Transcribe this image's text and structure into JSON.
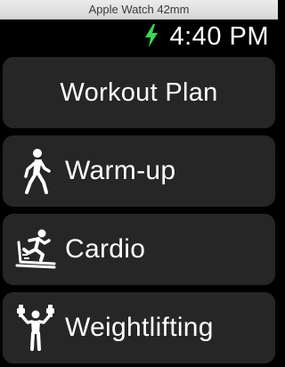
{
  "window": {
    "title": "Apple Watch 42mm"
  },
  "status": {
    "time": "4:40 PM",
    "charging_color": "#3cd651"
  },
  "workout": {
    "title": "Workout Plan",
    "items": [
      {
        "label": "Warm-up",
        "icon": "walking-person-icon"
      },
      {
        "label": "Cardio",
        "icon": "treadmill-runner-icon"
      },
      {
        "label": "Weightlifting",
        "icon": "weightlifter-icon"
      }
    ]
  }
}
